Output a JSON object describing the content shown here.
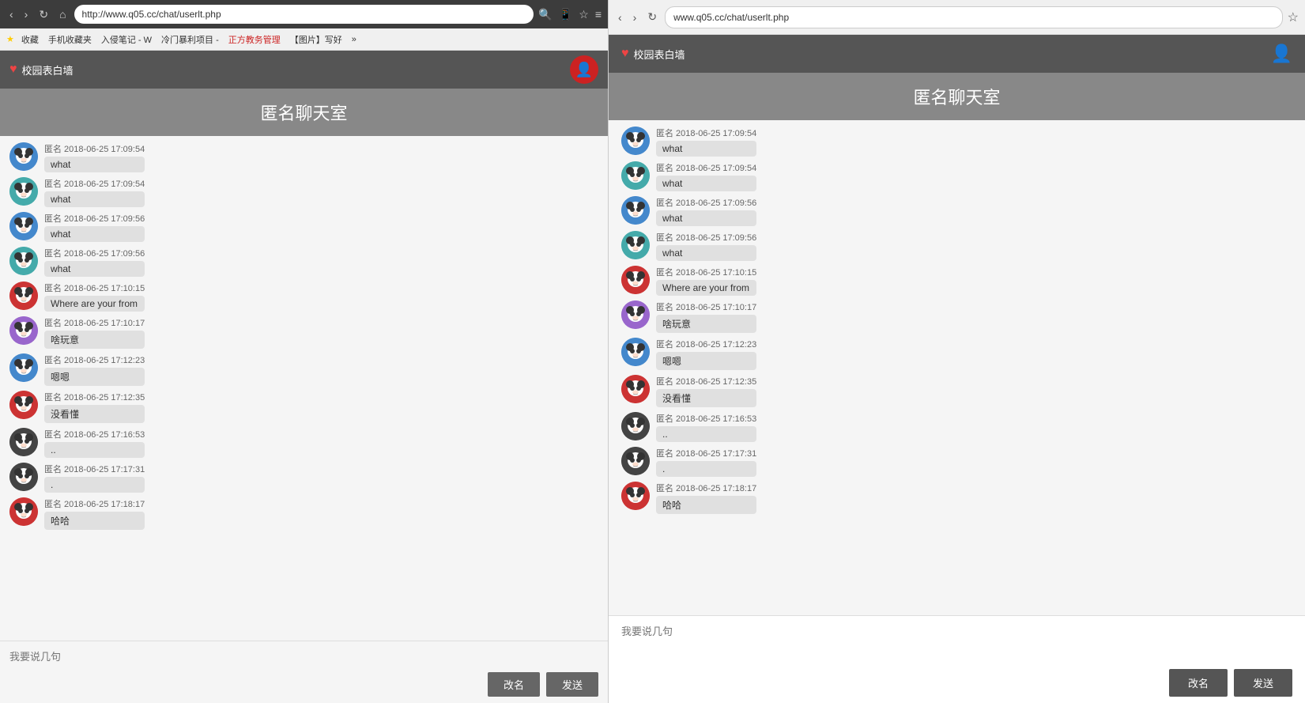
{
  "left": {
    "browser": {
      "url": "http://www.q05.cc/chat/userlt.php",
      "bookmarks": [
        "收藏",
        "手机收藏夹",
        "入侵笔记 - W",
        "冷门暴利项目 -",
        "正方教务管理",
        "【图片】写好",
        "»"
      ]
    },
    "app": {
      "site_name": "校园表白墙",
      "title": "匿名聊天室",
      "input_placeholder": "我要说几句",
      "btn_rename": "改名",
      "btn_send": "发送"
    },
    "messages": [
      {
        "user": "匿名",
        "time": "2018-06-25 17:09:54",
        "text": "what",
        "color": "blue"
      },
      {
        "user": "匿名",
        "time": "2018-06-25 17:09:54",
        "text": "what",
        "color": "teal"
      },
      {
        "user": "匿名",
        "time": "2018-06-25 17:09:56",
        "text": "what",
        "color": "blue"
      },
      {
        "user": "匿名",
        "time": "2018-06-25 17:09:56",
        "text": "what",
        "color": "teal"
      },
      {
        "user": "匿名",
        "time": "2018-06-25 17:10:15",
        "text": "Where are your from",
        "color": "red"
      },
      {
        "user": "匿名",
        "time": "2018-06-25 17:10:17",
        "text": "啥玩意",
        "color": "purple"
      },
      {
        "user": "匿名",
        "time": "2018-06-25 17:12:23",
        "text": "嗯嗯",
        "color": "blue"
      },
      {
        "user": "匿名",
        "time": "2018-06-25 17:12:35",
        "text": "没看懂",
        "color": "red"
      },
      {
        "user": "匿名",
        "time": "2018-06-25 17:16:53",
        "text": "..",
        "color": "dark"
      },
      {
        "user": "匿名",
        "time": "2018-06-25 17:17:31",
        "text": ".",
        "color": "dark"
      },
      {
        "user": "匿名",
        "time": "2018-06-25 17:18:17",
        "text": "哈哈",
        "color": "red"
      }
    ]
  },
  "right": {
    "browser": {
      "url": "www.q05.cc/chat/userlt.php"
    },
    "app": {
      "site_name": "校园表白墙",
      "title": "匿名聊天室",
      "input_placeholder": "我要说几句",
      "btn_rename": "改名",
      "btn_send": "发送"
    },
    "messages": [
      {
        "user": "匿名",
        "time": "2018-06-25 17:09:54",
        "text": "what",
        "color": "blue"
      },
      {
        "user": "匿名",
        "time": "2018-06-25 17:09:54",
        "text": "what",
        "color": "teal"
      },
      {
        "user": "匿名",
        "time": "2018-06-25 17:09:56",
        "text": "what",
        "color": "blue"
      },
      {
        "user": "匿名",
        "time": "2018-06-25 17:09:56",
        "text": "what",
        "color": "teal"
      },
      {
        "user": "匿名",
        "time": "2018-06-25 17:10:15",
        "text": "Where are your from",
        "color": "red"
      },
      {
        "user": "匿名",
        "time": "2018-06-25 17:10:17",
        "text": "啥玩意",
        "color": "purple"
      },
      {
        "user": "匿名",
        "time": "2018-06-25 17:12:23",
        "text": "嗯嗯",
        "color": "blue"
      },
      {
        "user": "匿名",
        "time": "2018-06-25 17:12:35",
        "text": "没看懂",
        "color": "red"
      },
      {
        "user": "匿名",
        "time": "2018-06-25 17:16:53",
        "text": "..",
        "color": "dark"
      },
      {
        "user": "匿名",
        "time": "2018-06-25 17:17:31",
        "text": ".",
        "color": "dark"
      },
      {
        "user": "匿名",
        "time": "2018-06-25 17:18:17",
        "text": "哈哈",
        "color": "red"
      }
    ]
  }
}
